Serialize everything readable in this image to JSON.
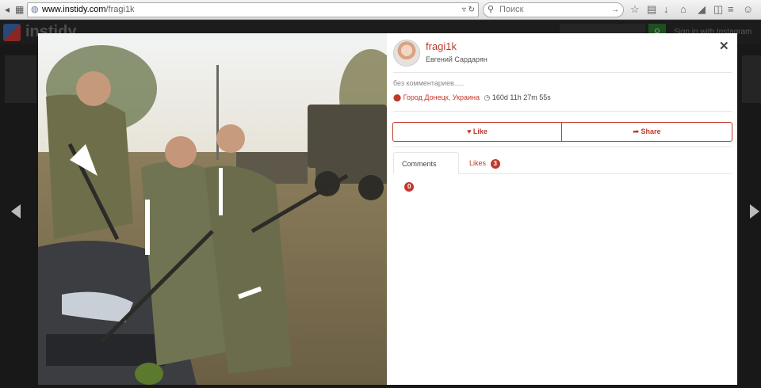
{
  "browser": {
    "url_domain": "www.instidy.com",
    "url_path": "/fragi1k",
    "search_placeholder": "Поиск"
  },
  "site": {
    "logo": "instidy",
    "signin": "Sign in with Instagram"
  },
  "post": {
    "username": "fragi1k",
    "full_name": "Евгений Сардарян",
    "caption": "без комментариев.....",
    "location": "Город Донецк, Украина",
    "time_ago": "160d 11h 27m 55s",
    "like_label": "Like",
    "share_label": "Share",
    "comments_label": "Comments",
    "comments_count": "0",
    "likes_label": "Likes",
    "likes_count": "3"
  },
  "colors": {
    "accent": "#c0392b"
  },
  "icons": [
    "globe-icon",
    "reload-icon",
    "search-icon",
    "star-icon",
    "bookmark-icon",
    "download-icon",
    "home-icon",
    "send-icon",
    "chat-icon",
    "close-icon",
    "heart-icon",
    "share-icon",
    "map-marker-icon",
    "clock-icon",
    "arrow-left-icon",
    "arrow-right-icon"
  ]
}
